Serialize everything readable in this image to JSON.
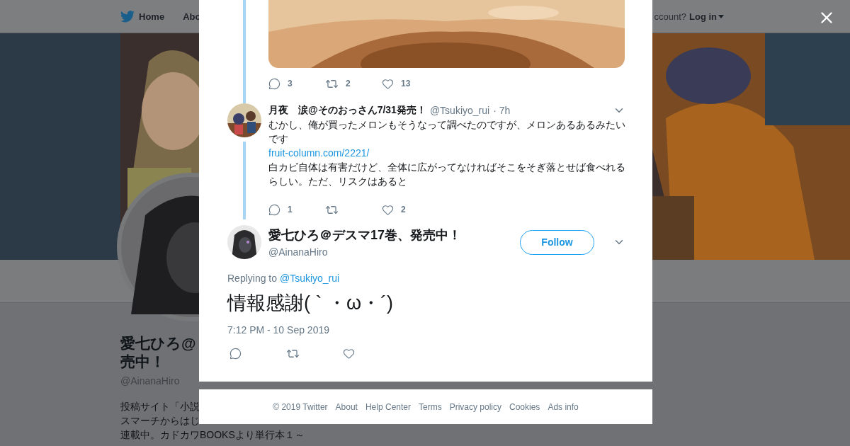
{
  "nav": {
    "items": [
      {
        "label": "Home",
        "kind": "home"
      },
      {
        "label": "Abo",
        "kind": "plain"
      }
    ],
    "account_prompt": "ccount?",
    "login": "Log in"
  },
  "banner": {
    "kind": "picture"
  },
  "profile": {
    "avatar": {
      "kind": "picture"
    },
    "name_lines": [
      "愛七ひろ@",
      "売中！"
    ],
    "handle": "@AinanaHiro",
    "bio_lines": [
      "投稿サイト「小説",
      "スマーチからはじ",
      "連載中。カドカワBOOKSより単行本１～"
    ]
  },
  "thread_top": {
    "media": {
      "kind": "picture"
    },
    "actions": [
      {
        "kind": "reply",
        "count": "3"
      },
      {
        "kind": "retweet",
        "count": "2"
      },
      {
        "kind": "like",
        "count": "13"
      }
    ]
  },
  "reply_tweet": {
    "avatar": {
      "kind": "picture"
    },
    "name": "月夜　涙@そのおっさん7/31発売！",
    "handle": "@Tsukiyo_rui",
    "time": "· 7h",
    "paragraphs": [
      {
        "kind": "text",
        "text": "むかし、俺が買ったメロンもそうなって調べたのですが、メロンあるあるみたいです"
      },
      {
        "kind": "link",
        "text": "fruit-column.com/2221/"
      },
      {
        "kind": "text",
        "text": "白カビ自体は有害だけど、全体に広がってなければそこをそぎ落とせば食べれるらしい。ただ、リスクはあると"
      }
    ],
    "actions": [
      {
        "kind": "reply",
        "count": "1"
      },
      {
        "kind": "retweet"
      },
      {
        "kind": "like",
        "count": "2"
      }
    ]
  },
  "focused_tweet": {
    "avatar": {
      "kind": "picture"
    },
    "name": "愛七ひろ＠デスマ17巻、発売中！",
    "handle": "@AinanaHiro",
    "follow": "Follow",
    "replying_label": "Replying to",
    "replying_to": "@Tsukiyo_rui",
    "text": "情報感謝( ` ・ω・´)",
    "timestamp": "7:12 PM - 10 Sep 2019",
    "actions": [
      {
        "kind": "reply"
      },
      {
        "kind": "retweet"
      },
      {
        "kind": "like"
      }
    ]
  },
  "footer": [
    "© 2019 Twitter",
    "About",
    "Help Center",
    "Terms",
    "Privacy policy",
    "Cookies",
    "Ads info"
  ]
}
